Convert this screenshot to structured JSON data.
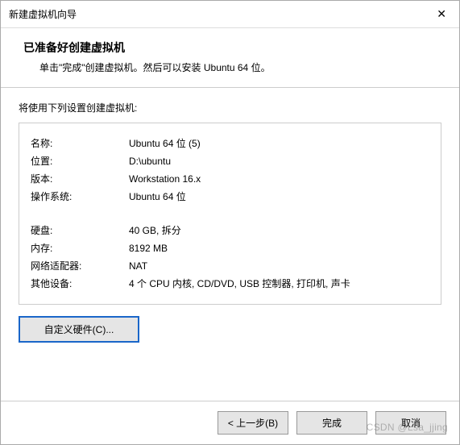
{
  "window": {
    "title": "新建虚拟机向导",
    "close": "✕"
  },
  "header": {
    "title": "已准备好创建虚拟机",
    "subtitle": "单击\"完成\"创建虚拟机。然后可以安装 Ubuntu 64 位。"
  },
  "content": {
    "intro": "将使用下列设置创建虚拟机:",
    "rows": [
      {
        "k": "名称:",
        "v": "Ubuntu 64 位 (5)"
      },
      {
        "k": "位置:",
        "v": "D:\\ubuntu"
      },
      {
        "k": "版本:",
        "v": "Workstation 16.x"
      },
      {
        "k": "操作系统:",
        "v": "Ubuntu 64 位"
      }
    ],
    "rows2": [
      {
        "k": "硬盘:",
        "v": "40 GB, 拆分"
      },
      {
        "k": "内存:",
        "v": "8192 MB"
      },
      {
        "k": "网络适配器:",
        "v": "NAT"
      },
      {
        "k": "其他设备:",
        "v": "4 个 CPU 内核, CD/DVD, USB 控制器, 打印机, 声卡"
      }
    ],
    "customize": "自定义硬件(C)..."
  },
  "footer": {
    "back": "< 上一步(B)",
    "finish": "完成",
    "cancel": "取消"
  },
  "watermark": "CSDN @Lsa_jjing"
}
